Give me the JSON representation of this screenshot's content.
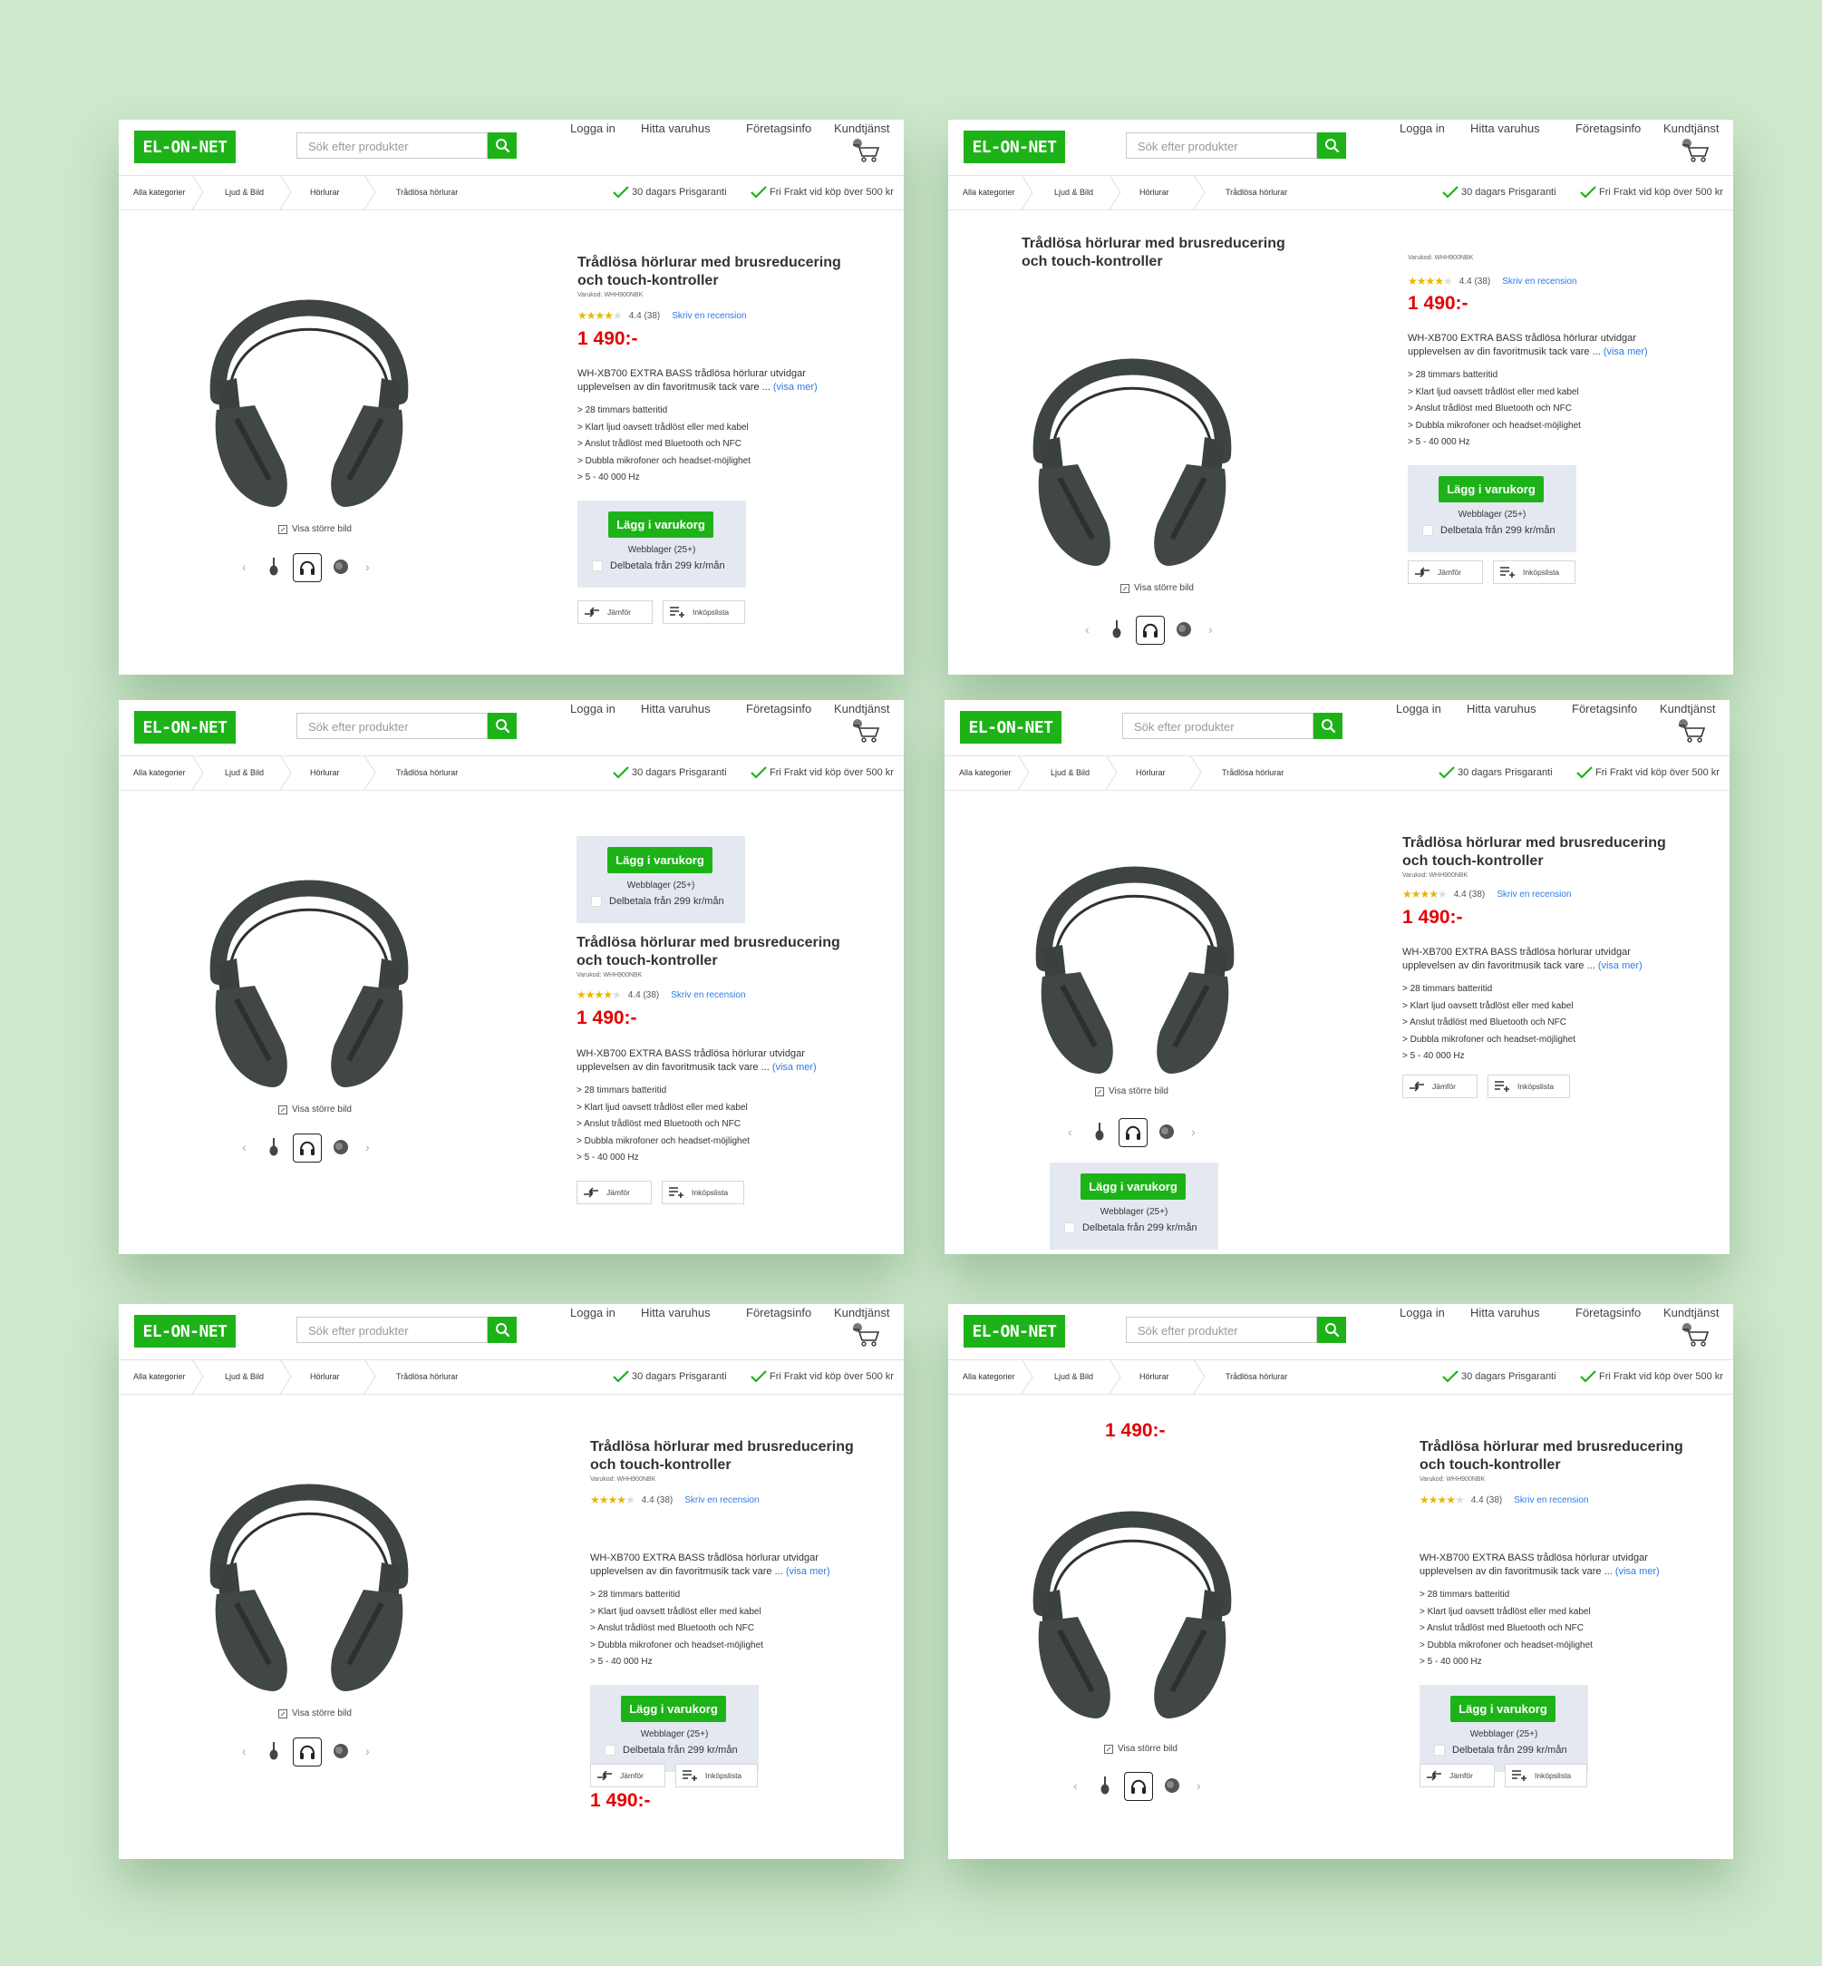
{
  "header": {
    "logo": "EL-ON-NET",
    "search_placeholder": "Sök efter produkter",
    "nav": [
      "Logga in",
      "Hitta varuhus",
      "Företagsinfo",
      "Kundtjänst"
    ]
  },
  "breadcrumbs": [
    "Alla kategorier",
    "Ljud & Bild",
    "Hörlurar",
    "Trådlösa hörlurar"
  ],
  "usps": [
    "30 dagars Prisgaranti",
    "Fri Frakt vid köp över 500 kr"
  ],
  "product": {
    "title_line1": "Trådlösa hörlurar med brusreducering",
    "title_line2": "och touch-kontroller",
    "sku": "Varukod: WHH900NBK",
    "rating_stars": 4.4,
    "rating_text": "4.4 (38)",
    "review_link": "Skriv en recension",
    "price": "1 490:-",
    "desc_line1": "WH-XB700 EXTRA BASS trådlösa hörlurar utvidgar",
    "desc_line2": "upplevelsen av din favoritmusik tack vare ...",
    "desc_more": "(visa mer)",
    "features": [
      "> 28 timmars batteritid",
      "> Klart ljud oavsett trådlöst eller med kabel",
      "> Anslut trådlöst med Bluetooth och NFC",
      "> Dubbla mikrofoner och headset-möjlighet",
      "> 5 - 40 000 Hz"
    ],
    "view_larger": "Visa större bild",
    "add_to_cart": "Lägg i varukorg",
    "stock": "Webblager (25+)",
    "installment": "Delbetala från 299 kr/mån",
    "compare": "Jämför",
    "shopping_list": "Inköpslista"
  },
  "colors": {
    "brand_green": "#1db318",
    "price_red": "#e40000",
    "link_blue": "#2c7be5",
    "buy_box": "#e4e9f1",
    "background": "#cde8cc"
  }
}
